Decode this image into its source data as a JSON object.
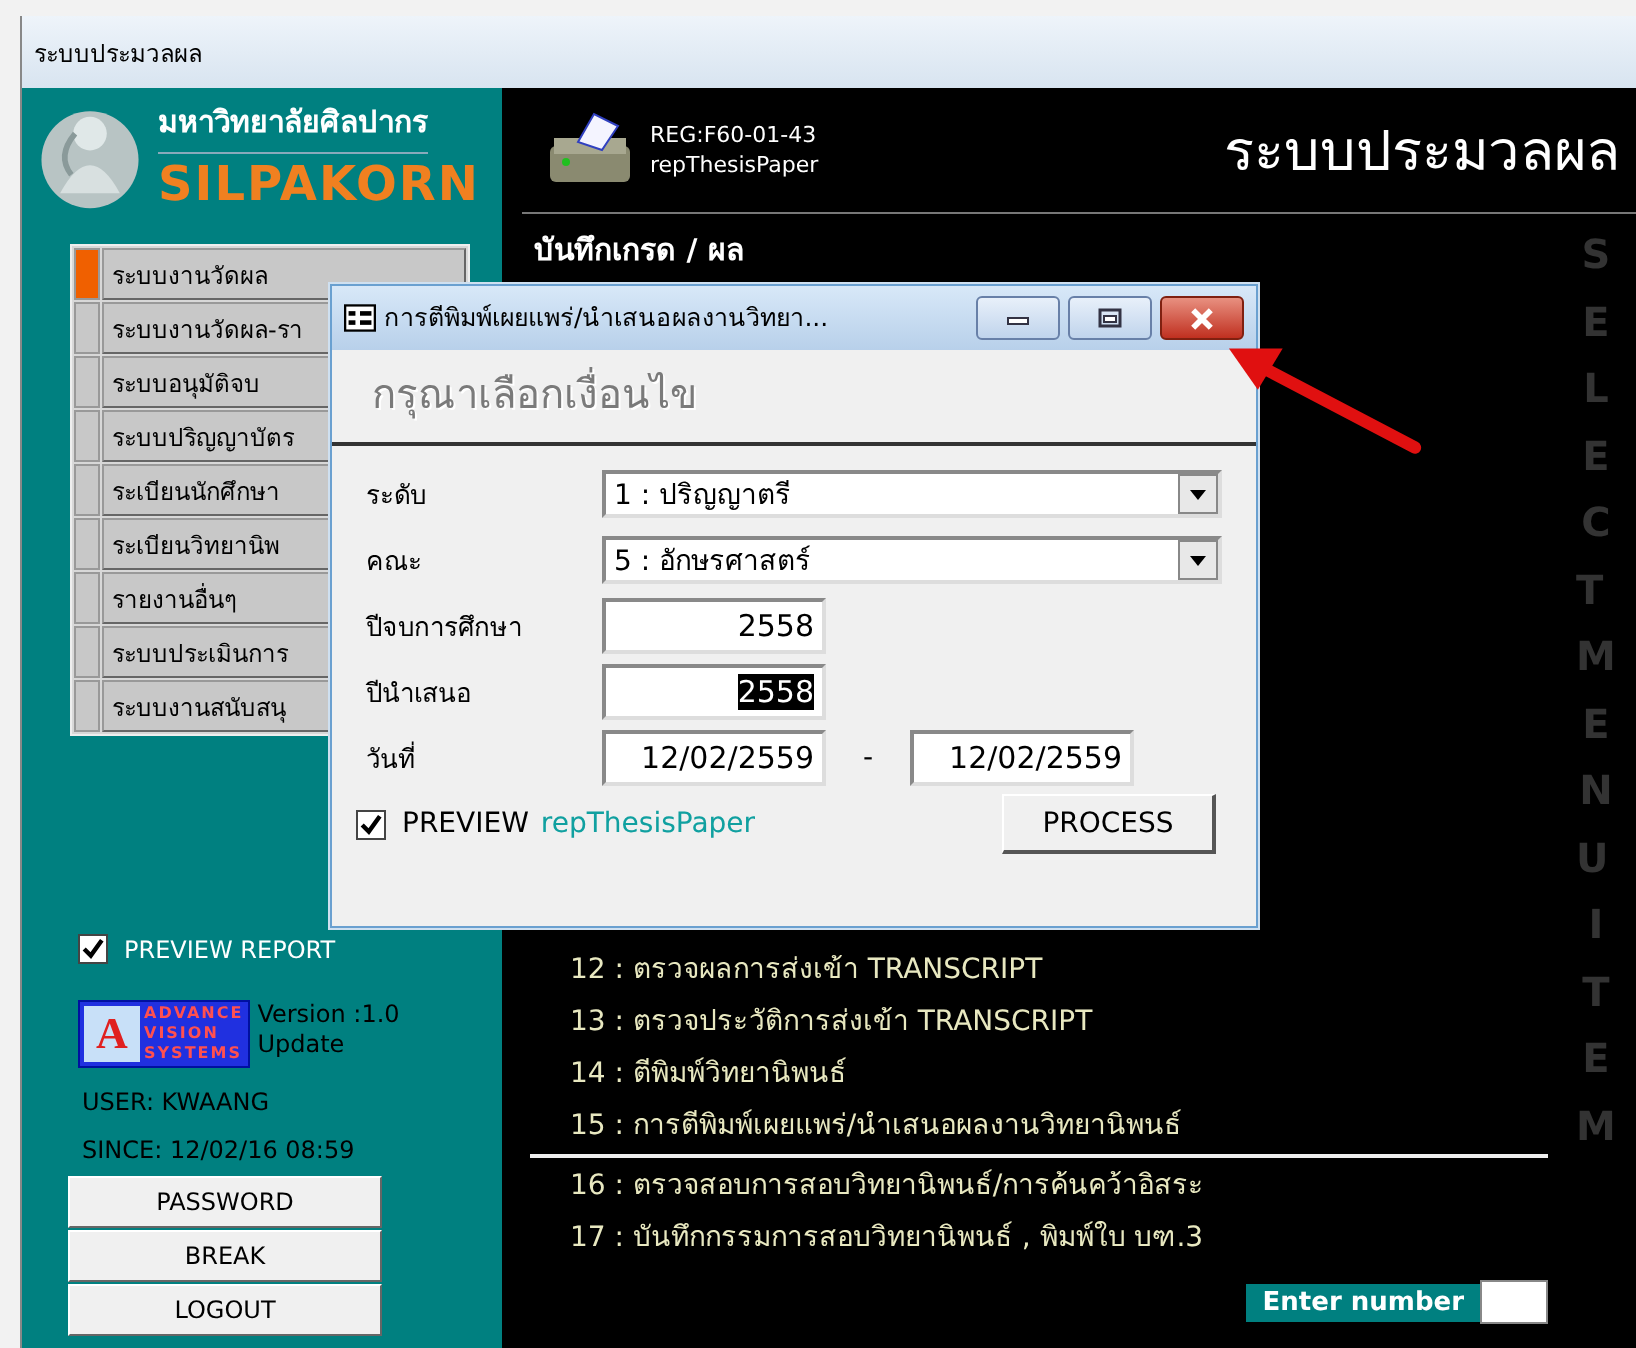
{
  "window": {
    "title": "ระบบประมวลผล"
  },
  "sidebar": {
    "university": "มหาวิทยาลัยศิลปากร",
    "brand": "SILPAKORN",
    "menu": [
      {
        "label": "ระบบงานวัดผล",
        "selected": true
      },
      {
        "label": "ระบบงานวัดผล-รา",
        "selected": false
      },
      {
        "label": "ระบบอนุมัติจบ",
        "selected": false
      },
      {
        "label": "ระบบปริญญาบัตร",
        "selected": false
      },
      {
        "label": "ระเบียนนักศึกษา",
        "selected": false
      },
      {
        "label": "ระเบียนวิทยานิพ",
        "selected": false
      },
      {
        "label": "รายงานอื่นๆ",
        "selected": false
      },
      {
        "label": "ระบบประเมินการ",
        "selected": false
      },
      {
        "label": "ระบบงานสนับสนุ",
        "selected": false
      }
    ],
    "preview_report": {
      "label": "PREVIEW REPORT",
      "checked": true
    },
    "vendor_logo": {
      "mark": "A",
      "lines": [
        "ADVANCE",
        "VISION",
        "SYSTEMS"
      ]
    },
    "version": [
      "Version :1.0",
      "Update"
    ],
    "user": "USER: KWAANG",
    "since": "SINCE: 12/02/16 08:59",
    "buttons": [
      "PASSWORD",
      "BREAK",
      "LOGOUT"
    ]
  },
  "header": {
    "report_code": "REG:F60-01-43",
    "report_name": "repThesisPaper",
    "title": "ระบบประมวลผล"
  },
  "main": {
    "heading": "บันทึกเกรด / ผล",
    "items": [
      {
        "text": "12 : ตรวจผลการส่งเข้า TRANSCRIPT",
        "divider_after": false
      },
      {
        "text": "13 : ตรวจประวัติการส่งเข้า TRANSCRIPT",
        "divider_after": false
      },
      {
        "text": "14 : ตีพิมพ์วิทยานิพนธ์",
        "divider_after": false
      },
      {
        "text": "15 : การตีพิมพ์เผยแพร่/นำเสนอผลงานวิทยานิพนธ์",
        "divider_after": true
      },
      {
        "text": "16 : ตรวจสอบการสอบวิทยานิพนธ์/การค้นคว้าอิสระ",
        "divider_after": false
      },
      {
        "text": "17 : บันทึกกรรมการสอบวิทยานิพนธ์ , พิมพ์ใบ บฑ.3",
        "divider_after": false
      }
    ],
    "side_label": "SELECT MENU ITEM",
    "enter_number": {
      "label": "Enter number"
    }
  },
  "dialog": {
    "title": "การตีพิมพ์เผยแพร่/นำเสนอผลงานวิทยา...",
    "prompt": "กรุณาเลือกเงื่อนไข",
    "fields": [
      {
        "kind": "select",
        "label": "ระดับ",
        "value": "1 : ปริญญาตรี"
      },
      {
        "kind": "select",
        "label": "คณะ",
        "value": "5 : อักษรศาสตร์"
      },
      {
        "kind": "text",
        "label": "ปีจบการศึกษา",
        "value": "2558",
        "highlighted": false
      },
      {
        "kind": "text",
        "label": "ปีนำเสนอ",
        "value": "2558",
        "highlighted": true
      },
      {
        "kind": "range",
        "label": "วันที่",
        "from": "12/02/2559",
        "separator": "-",
        "to": "12/02/2559"
      }
    ],
    "preview": {
      "label": "PREVIEW",
      "checked": true,
      "report": "repThesisPaper"
    },
    "button": "PROCESS"
  }
}
